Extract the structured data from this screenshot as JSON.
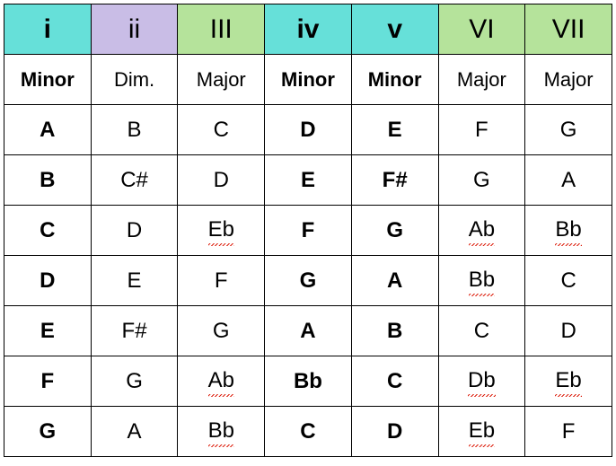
{
  "roman": {
    "i": "i",
    "ii": "ii",
    "III": "III",
    "iv": "iv",
    "v": "v",
    "VI": "VI",
    "VII": "VII"
  },
  "quality": {
    "i": "Minor",
    "ii": "Dim.",
    "III": "Major",
    "iv": "Minor",
    "v": "Minor",
    "VI": "Major",
    "VII": "Major"
  },
  "rows": [
    {
      "i": "A",
      "ii": "B",
      "III": "C",
      "iv": "D",
      "v": "E",
      "VI": "F",
      "VII": "G",
      "sq": {
        "III": false,
        "VI": false,
        "VII": false,
        "ii": false
      }
    },
    {
      "i": "B",
      "ii": "C#",
      "III": "D",
      "iv": "E",
      "v": "F#",
      "VI": "G",
      "VII": "A",
      "sq": {
        "III": false,
        "VI": false,
        "VII": false,
        "ii": false
      }
    },
    {
      "i": "C",
      "ii": "D",
      "III": "Eb",
      "iv": "F",
      "v": "G",
      "VI": "Ab",
      "VII": "Bb",
      "sq": {
        "III": true,
        "VI": true,
        "VII": true,
        "ii": false
      }
    },
    {
      "i": "D",
      "ii": "E",
      "III": "F",
      "iv": "G",
      "v": "A",
      "VI": "Bb",
      "VII": "C",
      "sq": {
        "III": false,
        "VI": true,
        "VII": false,
        "ii": false
      }
    },
    {
      "i": "E",
      "ii": "F#",
      "III": "G",
      "iv": "A",
      "v": "B",
      "VI": "C",
      "VII": "D",
      "sq": {
        "III": false,
        "VI": false,
        "VII": false,
        "ii": false
      }
    },
    {
      "i": "F",
      "ii": "G",
      "III": "Ab",
      "iv": "Bb",
      "v": "C",
      "VI": "Db",
      "VII": "Eb",
      "sq": {
        "III": true,
        "VI": true,
        "VII": true,
        "ii": false
      }
    },
    {
      "i": "G",
      "ii": "A",
      "III": "Bb",
      "iv": "C",
      "v": "D",
      "VI": "Eb",
      "VII": "F",
      "sq": {
        "III": true,
        "VI": true,
        "VII": false,
        "ii": false
      }
    }
  ],
  "chart_data": {
    "type": "table",
    "title": "Minor key diatonic chord chart",
    "columns": [
      "i",
      "ii",
      "III",
      "iv",
      "v",
      "VI",
      "VII"
    ],
    "column_qualities": [
      "Minor",
      "Dim.",
      "Major",
      "Minor",
      "Minor",
      "Major",
      "Major"
    ],
    "keys": [
      "A",
      "B",
      "C",
      "D",
      "E",
      "F",
      "G"
    ],
    "grid": [
      [
        "A",
        "B",
        "C",
        "D",
        "E",
        "F",
        "G"
      ],
      [
        "B",
        "C#",
        "D",
        "E",
        "F#",
        "G",
        "A"
      ],
      [
        "C",
        "D",
        "Eb",
        "F",
        "G",
        "Ab",
        "Bb"
      ],
      [
        "D",
        "E",
        "F",
        "G",
        "A",
        "Bb",
        "C"
      ],
      [
        "E",
        "F#",
        "G",
        "A",
        "B",
        "C",
        "D"
      ],
      [
        "F",
        "G",
        "Ab",
        "Bb",
        "C",
        "Db",
        "Eb"
      ],
      [
        "G",
        "A",
        "Bb",
        "C",
        "D",
        "Eb",
        "F"
      ]
    ]
  }
}
